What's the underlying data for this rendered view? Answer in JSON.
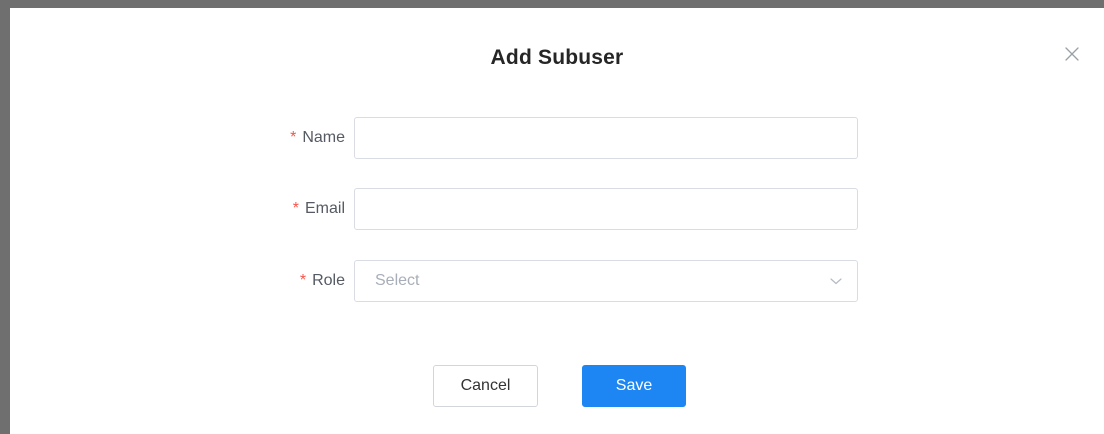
{
  "dialog": {
    "title": "Add Subuser",
    "close_icon": "close-icon"
  },
  "form": {
    "required_marker": "*",
    "name": {
      "label": "Name",
      "value": "",
      "placeholder": ""
    },
    "email": {
      "label": "Email",
      "value": "",
      "placeholder": ""
    },
    "role": {
      "label": "Role",
      "placeholder": "Select",
      "icon": "chevron-down-icon"
    }
  },
  "actions": {
    "cancel_label": "Cancel",
    "save_label": "Save"
  },
  "colors": {
    "primary": "#1e86f2",
    "required": "#f5544b",
    "border": "#d9dde3"
  }
}
